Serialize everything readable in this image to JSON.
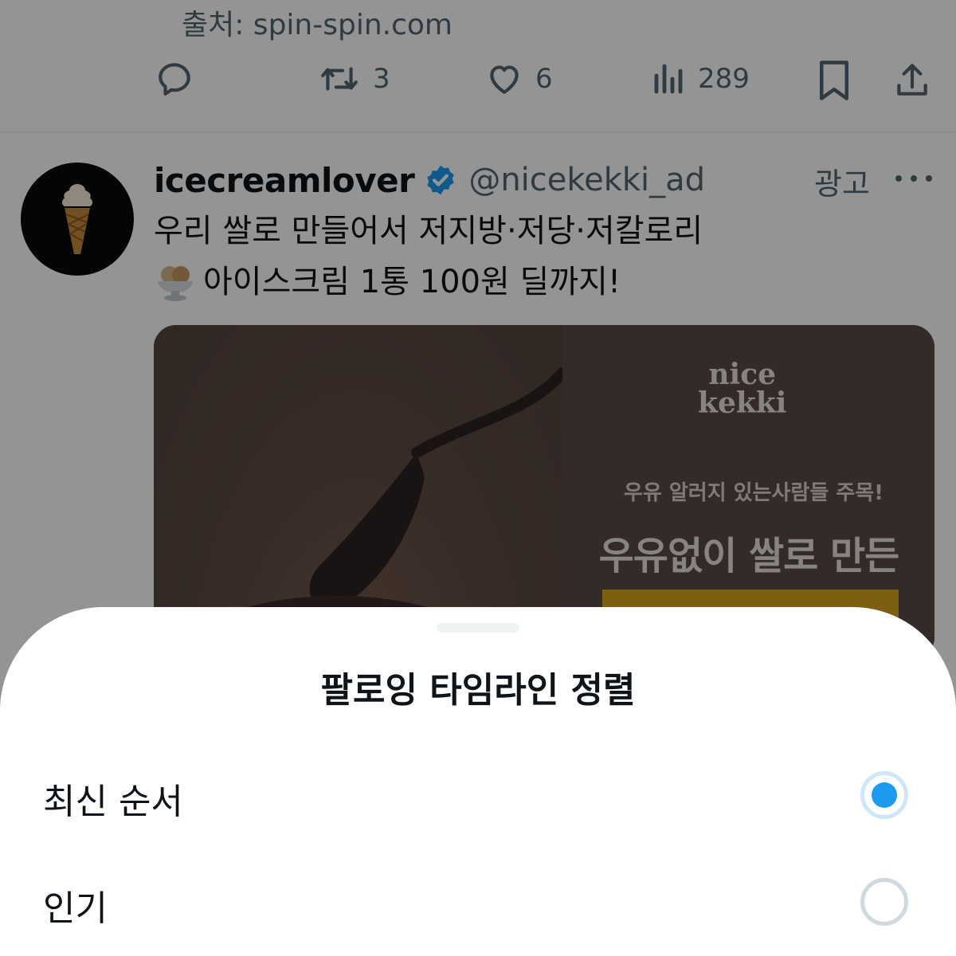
{
  "feed": {
    "previous_tweet": {
      "source_line": "출처: spin-spin.com",
      "actions": {
        "reply_icon": "reply-icon",
        "retweet_count": "3",
        "like_count": "6",
        "views_count": "289",
        "bookmark_icon": "bookmark-icon",
        "share_icon": "share-icon"
      }
    },
    "ad_tweet": {
      "display_name": "icecreamlover",
      "verified_icon": "verified-badge-icon",
      "handle": "@nicekekki_ad",
      "ad_label": "광고",
      "text_line1": "우리 쌀로 만들어서 저지방·저당·저칼로리",
      "text_line2": "아이스크림 1통 100원 딜까지!",
      "media": {
        "brand_line1": "nice",
        "brand_line2": "kekki",
        "subheadline": "우유 알러지 있는사람들 주목!",
        "headline": "우유없이 쌀로 만든"
      }
    }
  },
  "sheet": {
    "title": "팔로잉 타임라인 정렬",
    "options": [
      {
        "label": "최신 순서",
        "selected": true
      },
      {
        "label": "인기",
        "selected": false
      }
    ]
  },
  "colors": {
    "accent": "#1d9bf0",
    "secondary_text": "#536471",
    "primary_text": "#0f1419",
    "overlay": "rgba(0,0,0,0.42)"
  }
}
